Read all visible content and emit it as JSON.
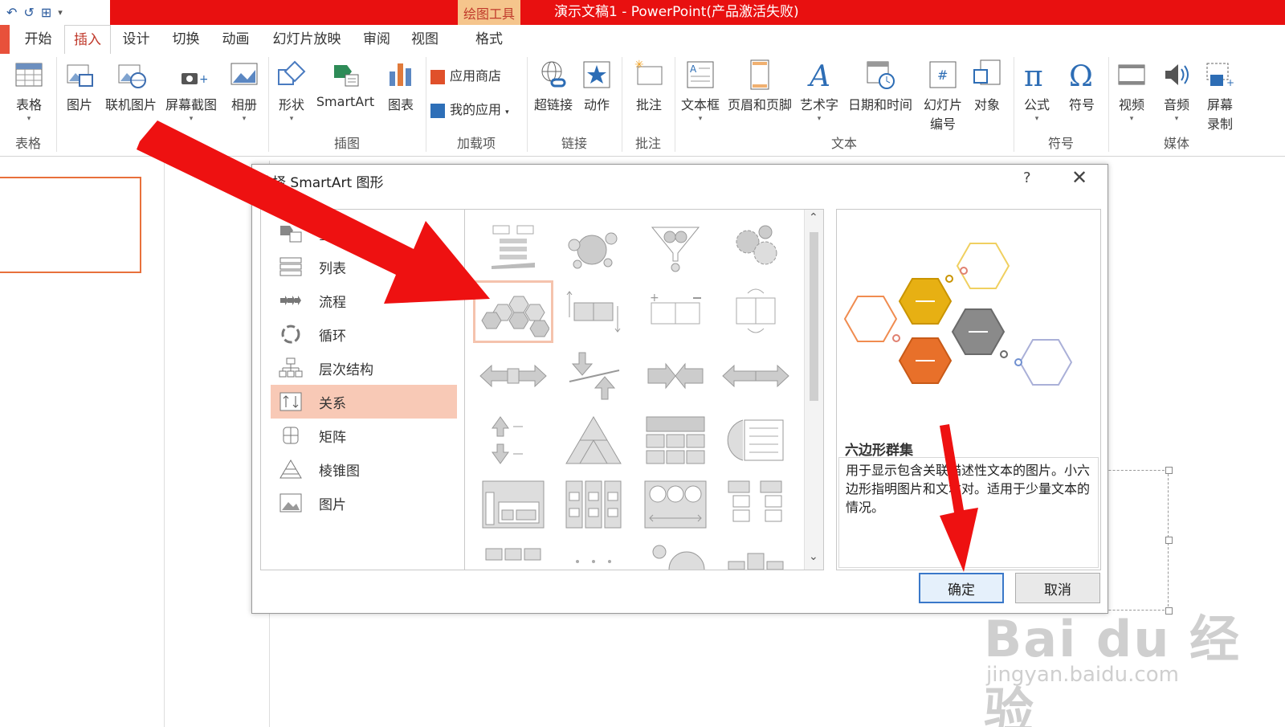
{
  "quick_access": {
    "undo": "↶",
    "redo": "↺",
    "present": "⊞",
    "more": "▾"
  },
  "title_bar": {
    "context_tab": "绘图工具",
    "title": "演示文稿1 -  PowerPoint(产品激活失败)"
  },
  "tabs": [
    {
      "label": "开始"
    },
    {
      "label": "插入"
    },
    {
      "label": "设计"
    },
    {
      "label": "切换"
    },
    {
      "label": "动画"
    },
    {
      "label": "幻灯片放映"
    },
    {
      "label": "审阅"
    },
    {
      "label": "视图"
    },
    {
      "label": "格式"
    }
  ],
  "ribbon": {
    "buttons": {
      "table": "表格",
      "picture": "图片",
      "online_picture": "联机图片",
      "screenshot": "屏幕截图",
      "album": "相册",
      "shapes": "形状",
      "smartart": "SmartArt",
      "chart": "图表",
      "store": "应用商店",
      "my_apps": "我的应用",
      "hyperlink": "超链接",
      "action": "动作",
      "comment": "批注",
      "textbox": "文本框",
      "header_footer": "页眉和页脚",
      "wordart": "艺术字",
      "datetime": "日期和时间",
      "slide_number_1": "幻灯片",
      "slide_number_2": "编号",
      "object": "对象",
      "equation": "公式",
      "symbol": "符号",
      "video": "视频",
      "audio": "音频",
      "screen_record_1": "屏幕",
      "screen_record_2": "录制"
    },
    "groups": {
      "tables": "表格",
      "illustrations": "插图",
      "addins": "加载项",
      "links": "链接",
      "comments": "批注",
      "text": "文本",
      "symbols": "符号",
      "media": "媒体"
    }
  },
  "dialog": {
    "title": "选择 SmartArt 图形",
    "help": "?",
    "close": "✕",
    "categories": [
      {
        "label": "全部"
      },
      {
        "label": "列表"
      },
      {
        "label": "流程"
      },
      {
        "label": "循环"
      },
      {
        "label": "层次结构"
      },
      {
        "label": "关系"
      },
      {
        "label": "矩阵"
      },
      {
        "label": "棱锥图"
      },
      {
        "label": "图片"
      }
    ],
    "selected_category": "关系",
    "preview": {
      "name": "六边形群集",
      "description": "用于显示包含关联描述性文本的图片。小六边形指明图片和文本对。适用于少量文本的情况。"
    },
    "ok": "确定",
    "cancel": "取消",
    "scroll_up": "⌃",
    "scroll_down": "⌄"
  },
  "watermark": {
    "main": "Bai du 经验",
    "sub": "jingyan.baidu.com"
  },
  "colors": {
    "title_bar": "#e81010",
    "active_tab": "#c0392b",
    "selection": "#f8c9b6",
    "arrow": "#ee1111"
  }
}
